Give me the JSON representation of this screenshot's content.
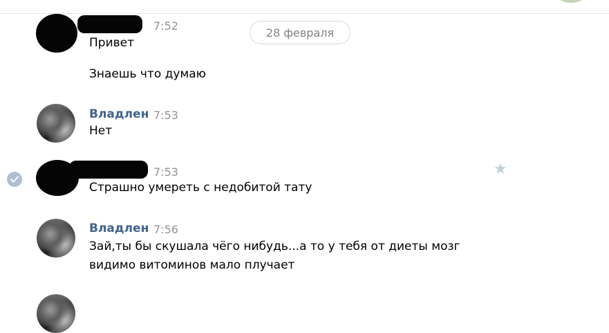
{
  "date_divider": "28 февраля",
  "messages": [
    {
      "time": "7:52",
      "lines": [
        "Привет",
        "Знаешь что думаю"
      ]
    },
    {
      "author": "Владлен",
      "time": "7:53",
      "lines": [
        "Нет"
      ]
    },
    {
      "time": "7:53",
      "lines": [
        "Страшно умереть с недобитой тату"
      ]
    },
    {
      "author": "Владлен",
      "time": "7:56",
      "lines": [
        "Зай,ты бы скушала чёго нибудь...а то у тебя от диеты мозг",
        "видимо витоминов мало плучает"
      ]
    }
  ],
  "icons": {
    "read_status": "check-circle-icon",
    "favorite": "star-icon"
  },
  "colors": {
    "author": "#42648b",
    "time": "#939393",
    "read_badge": "#aebfd3",
    "star": "#c5d0db"
  }
}
